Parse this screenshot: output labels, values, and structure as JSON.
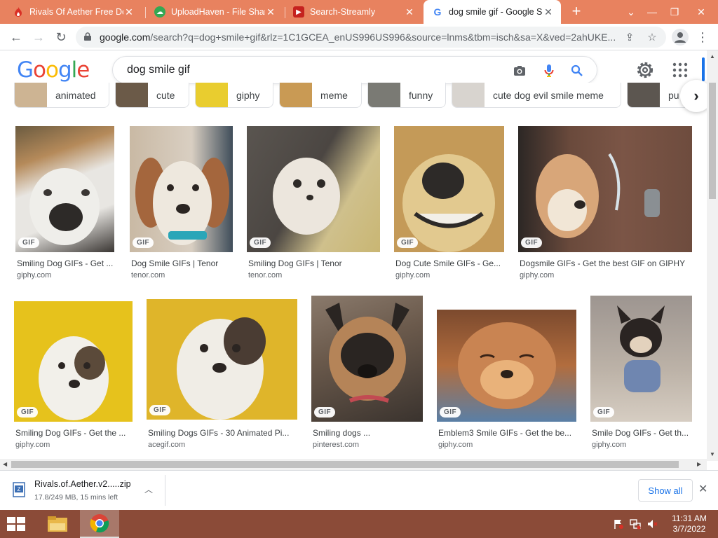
{
  "browser": {
    "tabs": [
      {
        "title": "Rivals Of Aether Free Dow",
        "favicon_color": "#d93025",
        "favicon_icon": "fire-icon"
      },
      {
        "title": "UploadHaven - File Sharin",
        "favicon_color": "#34a853",
        "favicon_icon": "cloud-icon"
      },
      {
        "title": "Search-Streamly",
        "favicon_color": "#c5221f",
        "favicon_icon": "streamly-icon"
      },
      {
        "title": "dog smile gif - Google Se",
        "favicon_color": "#4285f4",
        "favicon_icon": "google-icon"
      }
    ],
    "new_tab_label": "+",
    "url_host": "google.com",
    "url_path": "/search?q=dog+smile+gif&rlz=1C1GCEA_enUS996US996&source=lnms&tbm=isch&sa=X&ved=2ahUKE..."
  },
  "google": {
    "logo": [
      "G",
      "o",
      "o",
      "g",
      "l",
      "e"
    ],
    "logo_colors": [
      "#4285f4",
      "#ea4335",
      "#fbbc05",
      "#4285f4",
      "#34a853",
      "#ea4335"
    ],
    "query": "dog smile gif",
    "chips": [
      {
        "label": "animated",
        "thumb": "#cdb493"
      },
      {
        "label": "cute",
        "thumb": "#6b5a48"
      },
      {
        "label": "giphy",
        "thumb": "#e9cd2f"
      },
      {
        "label": "meme",
        "thumb": "#c99a54"
      },
      {
        "label": "funny",
        "thumb": "#7a7a74"
      },
      {
        "label": "cute dog evil smile meme",
        "thumb": "#d8d4cf"
      },
      {
        "label": "pu",
        "thumb": "#5c5650"
      }
    ]
  },
  "results": [
    {
      "title": "Smiling Dog GIFs - Get ...",
      "source": "giphy.com",
      "badge": "GIF",
      "colors": [
        "#8a7a60",
        "#e8e6e2",
        "#3a3633"
      ]
    },
    {
      "title": "Dog Smile GIFs | Tenor",
      "source": "tenor.com",
      "badge": "GIF",
      "colors": [
        "#5b6e80",
        "#e9e2d6",
        "#a4663d"
      ]
    },
    {
      "title": "Smiling Dog GIFs | Tenor",
      "source": "tenor.com",
      "badge": "GIF",
      "colors": [
        "#4b4642",
        "#e6e0d8",
        "#c9b673"
      ]
    },
    {
      "title": "Dog Cute Smile GIFs - Ge...",
      "source": "giphy.com",
      "badge": "GIF",
      "colors": [
        "#c49a58",
        "#e2c98f",
        "#2d2a28"
      ]
    },
    {
      "title": "Dogsmile GIFs - Get the best GIF on GIPHY",
      "source": "giphy.com",
      "badge": "GIF",
      "colors": [
        "#6a4a3c",
        "#d8a679",
        "#8a8f93"
      ]
    },
    {
      "title": "Smiling Dog GIFs - Get the ...",
      "source": "giphy.com",
      "badge": "GIF",
      "colors": [
        "#e6c21c",
        "#f2f0ea",
        "#5b4a3a"
      ]
    },
    {
      "title": "Smiling Dogs GIFs - 30 Animated Pi...",
      "source": "acegif.com",
      "badge": "GIF",
      "colors": [
        "#dfb52a",
        "#f0ede6",
        "#4a3c33"
      ]
    },
    {
      "title": "Smiling dogs ...",
      "source": "pinterest.com",
      "badge": "GIF",
      "colors": [
        "#6b5a4c",
        "#2a2522",
        "#b58458"
      ]
    },
    {
      "title": "Emblem3 Smile GIFs - Get the be...",
      "source": "giphy.com",
      "badge": "GIF",
      "colors": [
        "#b26d3e",
        "#7c4a2e",
        "#e9b27a"
      ]
    },
    {
      "title": "Smile Dog GIFs - Get th...",
      "source": "giphy.com",
      "badge": "GIF",
      "colors": [
        "#bdb3a8",
        "#2a2422",
        "#6f86b0"
      ]
    }
  ],
  "downloads": {
    "file_name": "Rivals.of.Aether.v2.....zip",
    "status": "17.8/249 MB, 15 mins left",
    "show_all": "Show all"
  },
  "taskbar": {
    "time": "11:31 AM",
    "date": "3/7/2022"
  }
}
